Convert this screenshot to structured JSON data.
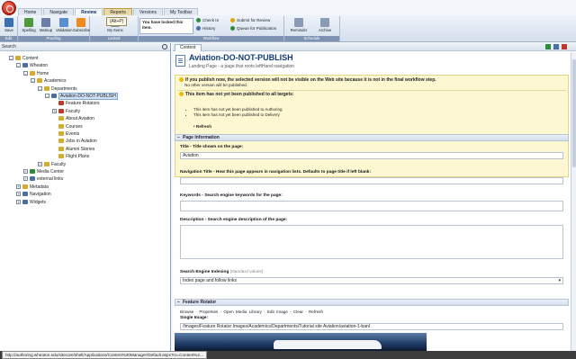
{
  "app": {
    "logo": "app-logo-icon"
  },
  "tabs": [
    "Home",
    "Navigate",
    "Review",
    "Reports",
    "Versions",
    "My Toolbar"
  ],
  "tooltip": "(Alt+P)",
  "ribbon": {
    "buttons": [
      {
        "label": "Save",
        "icon": "save-icon",
        "color": "#3a6fb0"
      },
      {
        "label": "Spelling",
        "icon": "spelling-icon",
        "color": "#4c9a3a"
      },
      {
        "label": "Markup",
        "icon": "markup-icon",
        "color": "#6b7fa6"
      },
      {
        "label": "Validation",
        "icon": "validation-icon",
        "color": "#5a8ed0"
      },
      {
        "label": "Subscribe",
        "icon": "rss-icon",
        "color": "#f08a1c"
      },
      {
        "label": "My Items",
        "icon": "my-items-icon",
        "color": "#7d8ea8"
      }
    ],
    "groups": [
      "Edit",
      "Proofing",
      "Locked",
      "Workflow",
      "Editor",
      "Schedule"
    ],
    "locked_note": "You have locked this item.",
    "workflow": [
      "Check In",
      "History",
      "Submit for Review",
      "Queue for Publication"
    ],
    "schedule": [
      "Reminder",
      "Archive"
    ],
    "workflow_colors": {
      "check": "#2e8b3a",
      "history": "#4a6fa5",
      "submit": "#e0a800",
      "queue": "#2e8b3a"
    }
  },
  "left": {
    "search_placeholder": "Search",
    "tree": [
      {
        "label": "Content",
        "depth": 0,
        "toggle": "–"
      },
      {
        "label": "Wheaton",
        "depth": 1,
        "toggle": "–"
      },
      {
        "label": "Home",
        "depth": 2,
        "toggle": "–"
      },
      {
        "label": "Academics",
        "depth": 3,
        "toggle": "–"
      },
      {
        "label": "Departments",
        "depth": 4,
        "toggle": "–"
      },
      {
        "label": "Aviation-DO-NOT-PUBLISH",
        "depth": 5,
        "toggle": "–",
        "selected": true
      },
      {
        "label": "Feature Rotators",
        "depth": 6,
        "toggle": ""
      },
      {
        "label": "Faculty",
        "depth": 6,
        "toggle": "+"
      },
      {
        "label": "About Aviation",
        "depth": 6,
        "toggle": ""
      },
      {
        "label": "Courses",
        "depth": 6,
        "toggle": ""
      },
      {
        "label": "Events",
        "depth": 6,
        "toggle": ""
      },
      {
        "label": "Jobs in Aviation",
        "depth": 6,
        "toggle": ""
      },
      {
        "label": "Alumni Stories",
        "depth": 6,
        "toggle": ""
      },
      {
        "label": "Flight Plans",
        "depth": 6,
        "toggle": ""
      },
      {
        "label": "Faculty",
        "depth": 4,
        "toggle": "+"
      },
      {
        "label": "Media Center",
        "depth": 2,
        "toggle": "+"
      },
      {
        "label": "external links",
        "depth": 2,
        "toggle": "+"
      },
      {
        "label": "Metadata",
        "depth": 1,
        "toggle": "+"
      },
      {
        "label": "Navigation",
        "depth": 1,
        "toggle": "+"
      },
      {
        "label": "Widgets",
        "depth": 1,
        "toggle": "+"
      }
    ]
  },
  "content": {
    "tab": "Content",
    "title": "Aviation-DO-NOT-PUBLISH",
    "subtitle": "Landing Page - a page that roots leftHand navigation",
    "warning1": "If you publish now, the selected version will not be visible on the Web site because it is not in the final workflow step.",
    "warning2": "No other version will be published.",
    "warning3": "This item has not yet been published to all targets:",
    "targets": [
      "This item has not yet been published to Authoring",
      "This item has not yet been published to Delivery"
    ],
    "refresh": "Refresh",
    "section1": "Page Information",
    "title_label": "Title - Title shown on the page:",
    "title_value": "Aviation",
    "nav_label": "Navigation Title - How this page appears in navigation lists. Defaults to page title if left blank:",
    "keywords_label": "Keywords - Search engine keywords for the page:",
    "desc_label": "Description - Search engine description of the page:",
    "indexing_label": "Search Engine Indexing",
    "indexing_hint": "[standard values]",
    "indexing_value": "Index page and follow links",
    "section2": "Feature Rotator",
    "media_actions": "Browse · Properties · Open Media Library · Edit Image · Clear · Refresh",
    "single_image_label": "Single Image:",
    "image_path": "/Images/Feature Rotator Images/Academics/Departments/Tutorial site Aviation/aviation-1-banl"
  },
  "status": {
    "url": "http://authoring.wheaton.edu/sitecore/shell/Applications/Content%20Manager/Default.aspx?ro=Content%2..."
  }
}
